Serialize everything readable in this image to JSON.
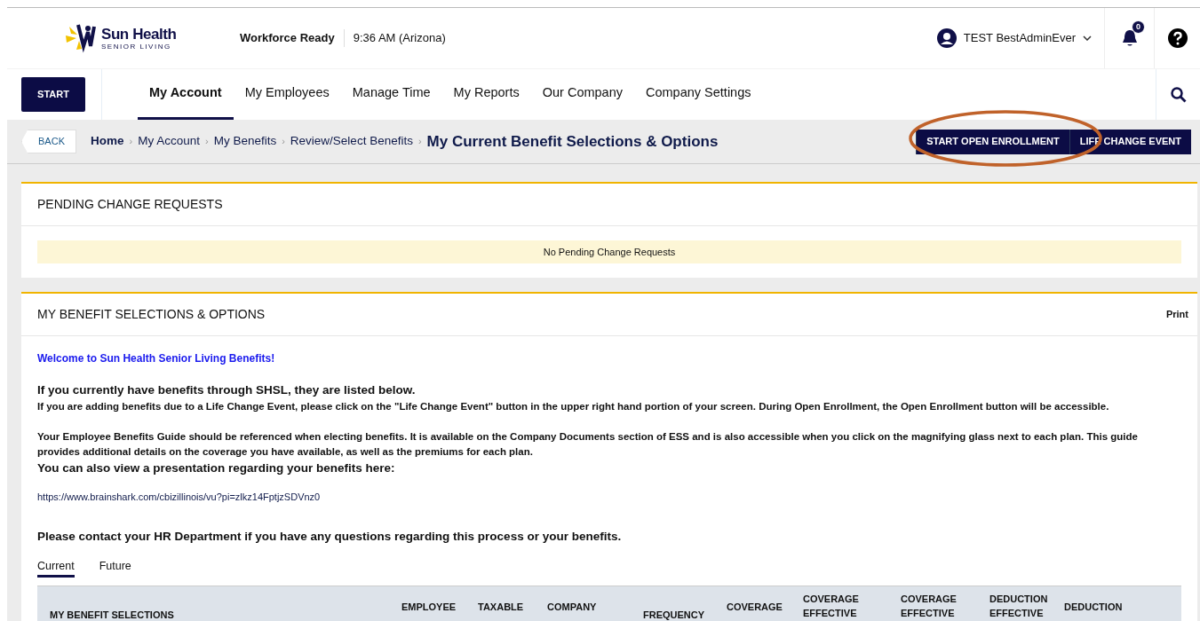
{
  "header": {
    "logo": {
      "name": "Sun Health",
      "tagline": "SENIOR LIVING"
    },
    "product": "Workforce Ready",
    "time": "9:36 AM (Arizona)",
    "user": "TEST BestAdminEver",
    "notifications": "0"
  },
  "nav": {
    "start": "START",
    "items": [
      {
        "label": "My Account",
        "selected": true
      },
      {
        "label": "My Employees",
        "selected": false
      },
      {
        "label": "Manage Time",
        "selected": false
      },
      {
        "label": "My Reports",
        "selected": false
      },
      {
        "label": "Our Company",
        "selected": false
      },
      {
        "label": "Company Settings",
        "selected": false
      }
    ]
  },
  "breadcrumb": {
    "back": "BACK",
    "separator": "›",
    "items": [
      "Home",
      "My Account",
      "My Benefits",
      "Review/Select Benefits"
    ],
    "current": "My Current Benefit Selections & Options",
    "actions": [
      "START OPEN ENROLLMENT",
      "LIFE CHANGE EVENT"
    ]
  },
  "pending": {
    "title": "PENDING CHANGE REQUESTS",
    "message": "No Pending Change Requests"
  },
  "selections": {
    "title": "MY BENEFIT SELECTIONS & OPTIONS",
    "print": "Print",
    "welcome": "Welcome to Sun Health Senior Living Benefits!",
    "intro_heading": "If you currently have benefits through SHSL, they are listed below.",
    "intro_text": "If you are adding benefits due to a Life Change Event, please click on the \"Life Change Event\" button in the upper right hand portion of your screen.  During Open Enrollment, the Open Enrollment button will be accessible.",
    "guide_text": "Your Employee Benefits Guide should be referenced when electing benefits.  It is available on the Company Documents section of ESS and is also accessible when you click on the magnifying glass next to each plan.  This guide provides additional details on the coverage you have available, as well as the premiums for each plan.",
    "presentation_heading": "You can also view a presentation regarding your benefits here:",
    "link": "https://www.brainshark.com/cbizillinois/vu?pi=zlkz14FptjzSDVnz0",
    "contact": "Please contact your HR Department if you have any questions regarding this process or your benefits.",
    "tabs": [
      {
        "label": "Current",
        "selected": true
      },
      {
        "label": "Future",
        "selected": false
      }
    ],
    "table": {
      "columns": [
        "MY BENEFIT SELECTIONS",
        "EMPLOYEE",
        "TAXABLE",
        "COMPANY",
        "FREQUENCY",
        "COVERAGE",
        "COVERAGE EFFECTIVE",
        "COVERAGE EFFECTIVE",
        "DEDUCTION EFFECTIVE",
        "DEDUCTION"
      ]
    }
  },
  "annotation": {
    "kind": "ellipse",
    "color": "#c0622a"
  }
}
